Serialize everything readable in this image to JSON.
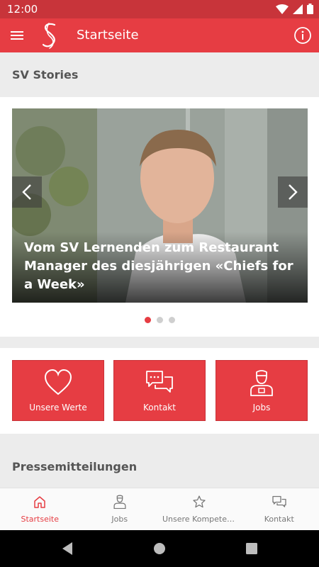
{
  "status_bar": {
    "time": "12:00"
  },
  "app_bar": {
    "title": "Startseite"
  },
  "stories": {
    "header": "SV Stories",
    "slide_title": "Vom SV Lernenden zum Restaurant Manager des diesjährigen «Chiefs for a Week»",
    "slide_count": 3,
    "active_slide": 1
  },
  "tiles": [
    {
      "label": "Unsere Werte",
      "icon": "heart-icon"
    },
    {
      "label": "Kontakt",
      "icon": "chat-bubbles-icon"
    },
    {
      "label": "Jobs",
      "icon": "worker-icon"
    }
  ],
  "press": {
    "header": "Pressemitteilungen"
  },
  "bottom_nav": [
    {
      "label": "Startseite",
      "icon": "home-icon",
      "active": true
    },
    {
      "label": "Jobs",
      "icon": "worker-icon",
      "active": false
    },
    {
      "label": "Unsere Kompeten…",
      "icon": "star-icon",
      "active": false
    },
    {
      "label": "Kontakt",
      "icon": "chat-bubbles-icon",
      "active": false
    }
  ],
  "colors": {
    "brand": "#e63d43",
    "status_bar": "#c8343a",
    "inactive": "#777777"
  }
}
